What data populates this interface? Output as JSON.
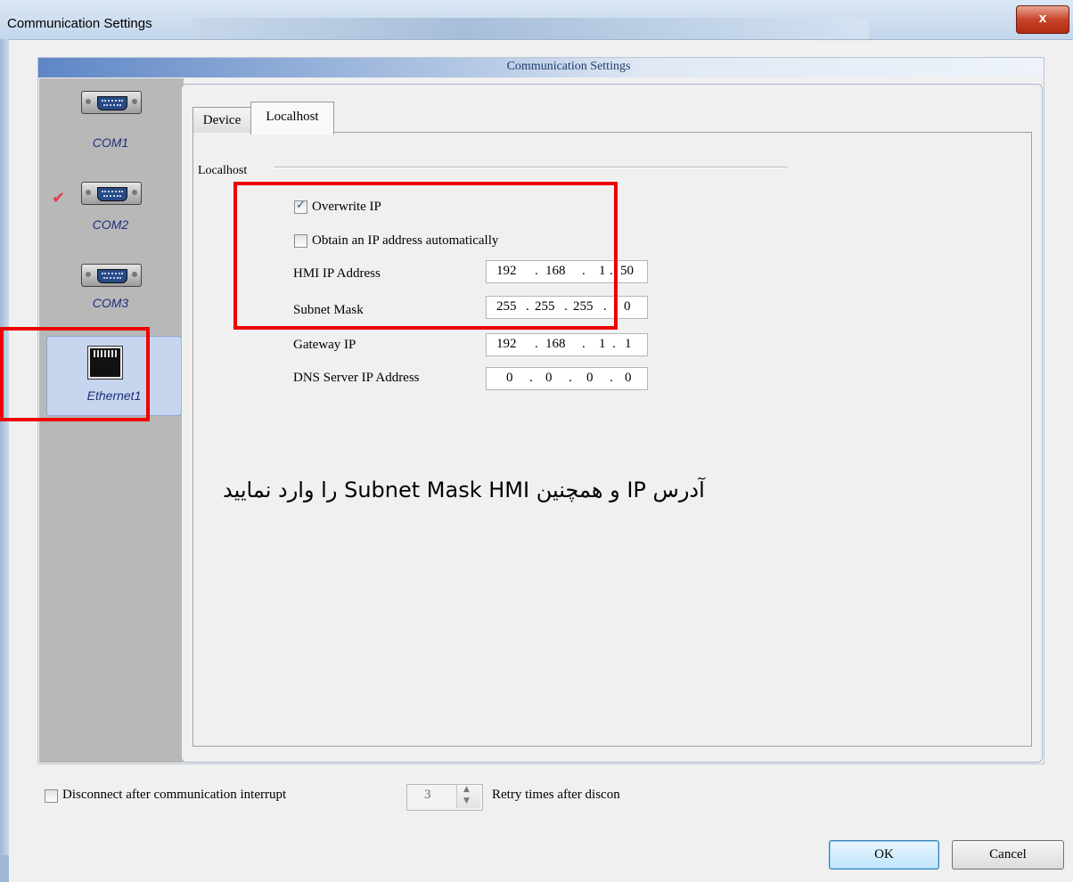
{
  "window": {
    "title": "Communication Settings",
    "close_label": "x"
  },
  "panel": {
    "header": "Communication Settings"
  },
  "sidebar": {
    "items": [
      {
        "label": "COM1",
        "icon": "serial-port-icon",
        "checked": false
      },
      {
        "label": "COM2",
        "icon": "serial-port-icon",
        "checked": true,
        "check_mark": "✔"
      },
      {
        "label": "COM3",
        "icon": "serial-port-icon",
        "checked": false
      },
      {
        "label": "Ethernet1",
        "icon": "ethernet-port-icon",
        "selected": true
      }
    ]
  },
  "tabs": [
    {
      "label": "Device",
      "active": false
    },
    {
      "label": "Localhost",
      "active": true
    }
  ],
  "localhost": {
    "group_label": "Localhost",
    "overwrite_ip": {
      "label": "Overwrite IP",
      "checked": true
    },
    "obtain_auto": {
      "label": "Obtain an IP address automatically",
      "checked": false
    },
    "fields": [
      {
        "label": "HMI IP Address",
        "octets": [
          "192",
          "168",
          "1",
          "50"
        ]
      },
      {
        "label": "Subnet Mask",
        "octets": [
          "255",
          "255",
          "255",
          "0"
        ]
      },
      {
        "label": "Gateway IP",
        "octets": [
          "192",
          "168",
          "1",
          "1"
        ]
      },
      {
        "label": "DNS Server IP Address",
        "octets": [
          "0",
          "0",
          "0",
          "0"
        ]
      }
    ],
    "octet_separator": "."
  },
  "annotation": {
    "text": "آدرس IP و همچنین Subnet Mask HMI را وارد نمایید",
    "highlight_color": "#ee0000"
  },
  "bottom": {
    "disconnect": {
      "label": "Disconnect after communication interrupt",
      "checked": false
    },
    "retry": {
      "value": "3",
      "label": "Retry times after discon"
    }
  },
  "buttons": {
    "ok": "OK",
    "cancel": "Cancel"
  }
}
